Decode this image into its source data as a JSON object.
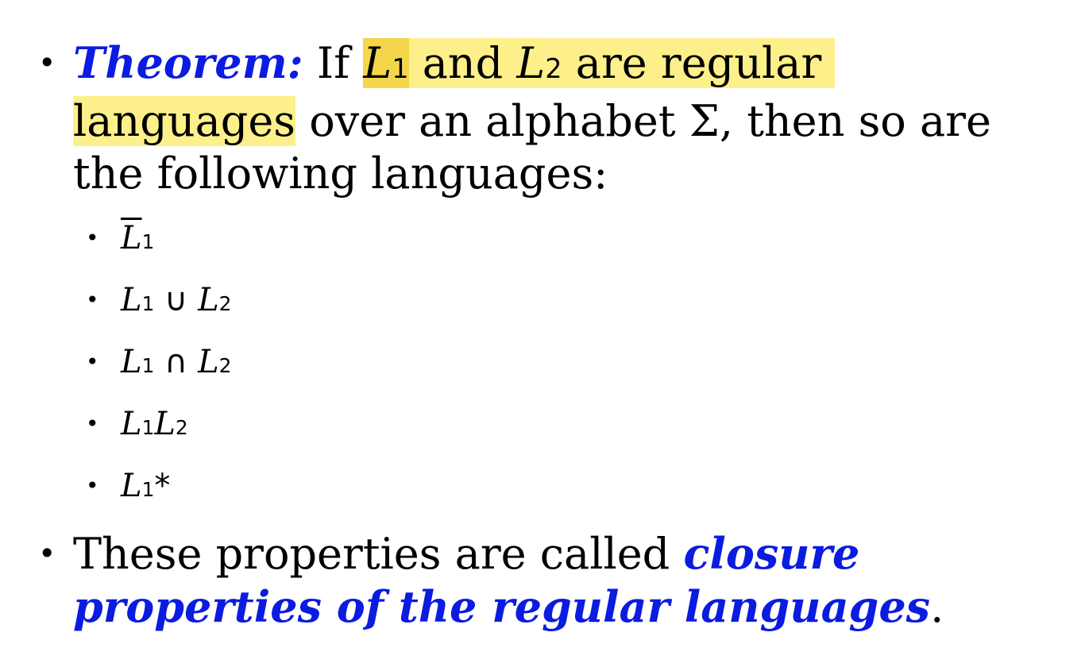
{
  "bullet1": {
    "label": "Theorem:",
    "if_word": "If",
    "L": "L",
    "sub1": "1",
    "sub2": "2",
    "and_word": "and",
    "rest_line1": "are regular",
    "languages_word": "languages",
    "rest_line2": "over an alphabet Σ, then so are the following languages:"
  },
  "sub_items": [
    {
      "name": "complement",
      "op": "",
      "second_sub": "",
      "star": ""
    },
    {
      "name": "union",
      "op": " ∪ ",
      "second_sub": "2"
    },
    {
      "name": "intersection",
      "op": " ∩ ",
      "second_sub": "2"
    },
    {
      "name": "concatenation",
      "op": "",
      "second_sub": "2"
    },
    {
      "name": "kleene-star",
      "star": "*"
    }
  ],
  "bullet2": {
    "text": "These properties are called",
    "emph": "closure properties of the regular languages",
    "period": "."
  },
  "colors": {
    "emphasis_blue": "#0b1be0",
    "highlight_yellow": "#fdf08a"
  }
}
